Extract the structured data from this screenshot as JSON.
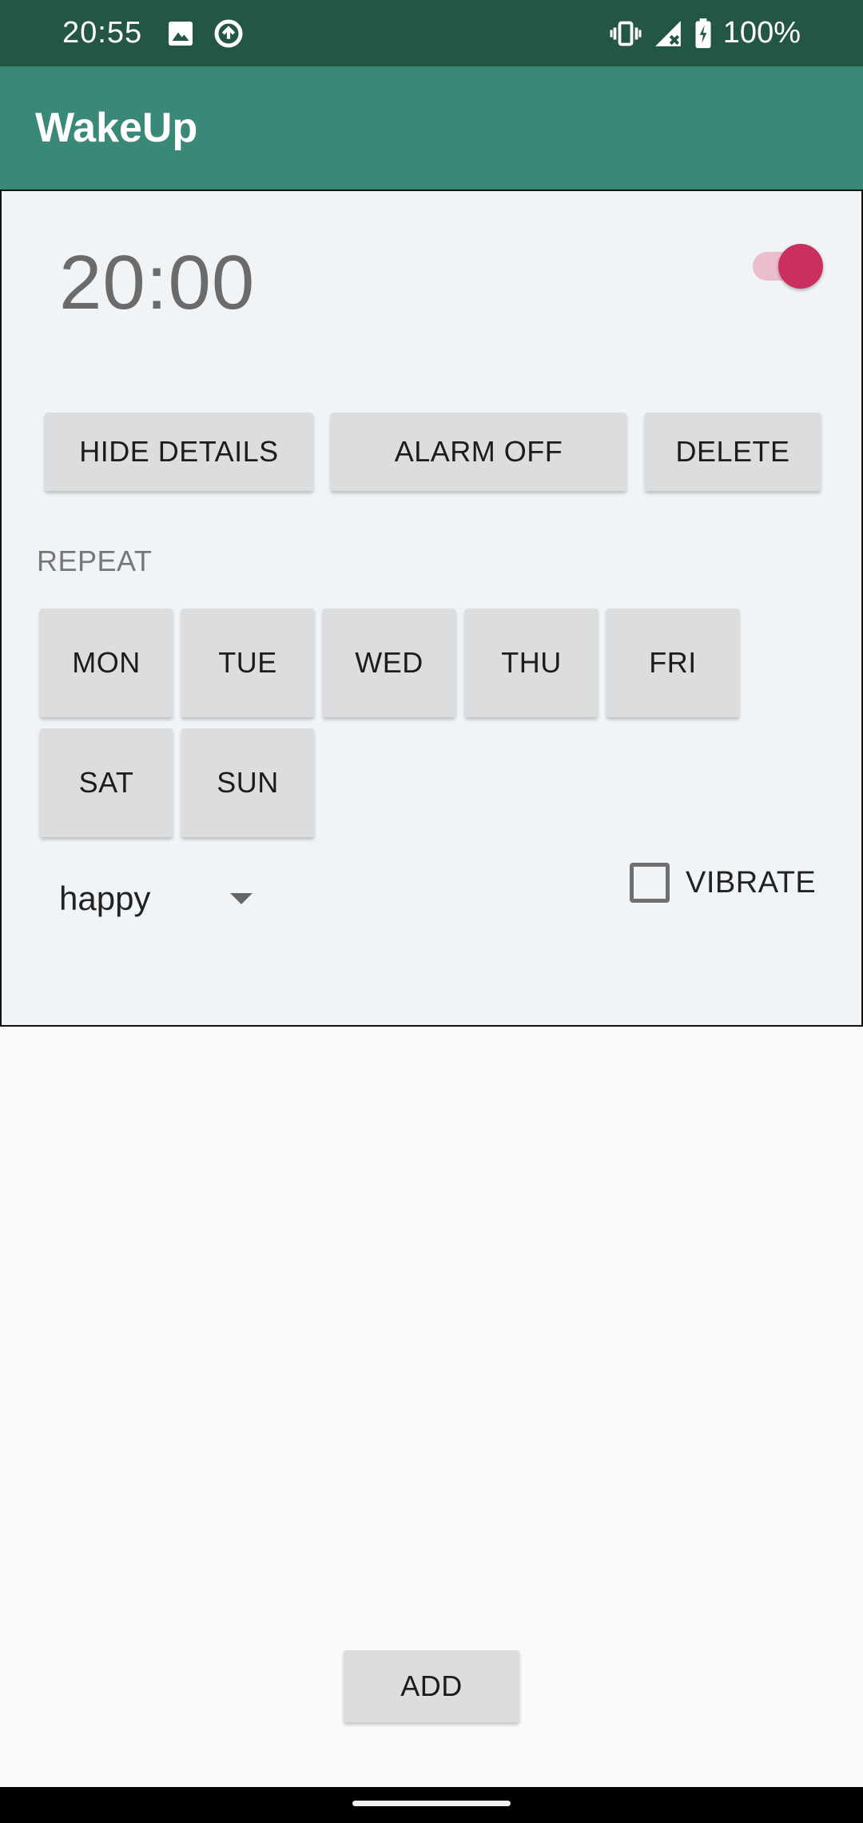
{
  "status_bar": {
    "time": "20:55",
    "battery": "100%",
    "icons": [
      "image-icon",
      "data-saver-icon",
      "vibrate-icon",
      "no-signal-icon",
      "battery-charging-icon"
    ]
  },
  "app_bar": {
    "title": "WakeUp"
  },
  "alarm": {
    "time": "20:00",
    "enabled": true,
    "buttons": {
      "hide_details": "HIDE DETAILS",
      "alarm_off": "ALARM OFF",
      "delete": "DELETE"
    },
    "repeat_label": "REPEAT",
    "days": [
      "MON",
      "TUE",
      "WED",
      "THU",
      "FRI",
      "SAT",
      "SUN"
    ],
    "ringtone": "happy",
    "vibrate_label": "VIBRATE",
    "vibrate_checked": false
  },
  "footer": {
    "add_label": "ADD"
  },
  "colors": {
    "status_bar": "#245648",
    "app_bar": "#3a8878",
    "accent": "#c93060",
    "card": "#f1f4f6"
  }
}
